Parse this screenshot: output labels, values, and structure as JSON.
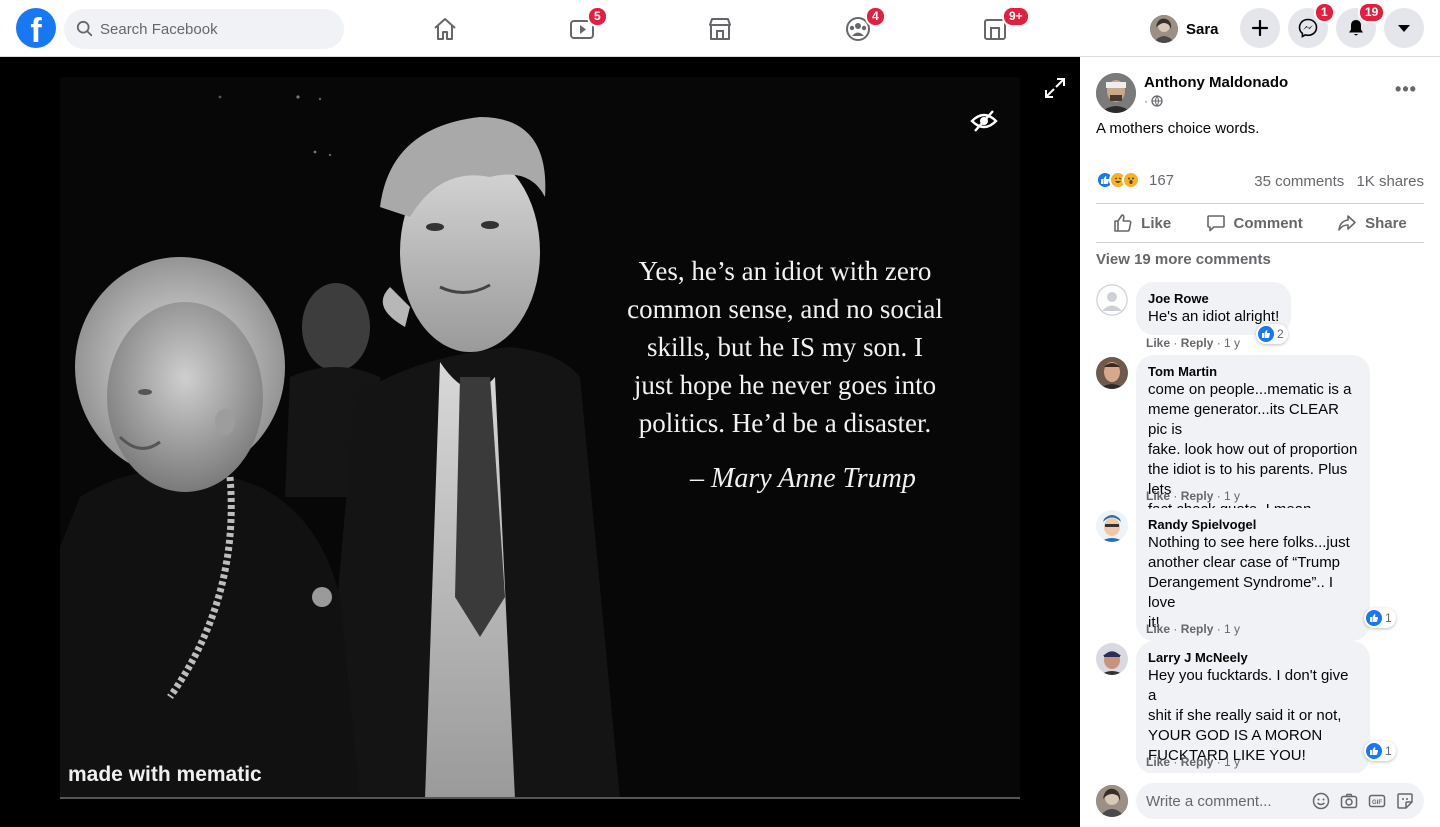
{
  "header": {
    "search": {
      "placeholder": "Search Facebook"
    },
    "nav": [
      {
        "name": "home",
        "icon": "home-icon",
        "badge": ""
      },
      {
        "name": "watch",
        "icon": "watch-icon",
        "badge": "5"
      },
      {
        "name": "marketplace",
        "icon": "marketplace-icon",
        "badge": ""
      },
      {
        "name": "groups",
        "icon": "groups-icon",
        "badge": "4"
      },
      {
        "name": "gaming",
        "icon": "gaming-icon",
        "badge": "9+"
      }
    ],
    "profile_name": "Sara",
    "messenger_badge": "1",
    "notifications_badge": "19",
    "colors": {
      "brand": "#1877f2",
      "badge": "#e41e3f"
    }
  },
  "photo": {
    "quote_lines": [
      "Yes, he’s an idiot with zero",
      "common sense, and no social",
      "skills, but he IS my son.  I",
      "just hope he never goes into",
      "politics. He’d be a disaster."
    ],
    "attribution": "– Mary Anne Trump",
    "watermark": "made with mematic"
  },
  "post": {
    "author": "Anthony Maldonado",
    "meta_dot": "·",
    "text": "A mothers choice words.",
    "reaction_count": "167",
    "comments_count": "35 comments",
    "shares_count": "1K shares",
    "actions": {
      "like": "Like",
      "comment": "Comment",
      "share": "Share"
    },
    "view_more": "View 19 more comments"
  },
  "comments": [
    {
      "name": "Joe Rowe",
      "text": "He's an idiot alright!",
      "like": "Like",
      "reply": "Reply",
      "age": "1 y",
      "reactions": "2"
    },
    {
      "name": "Tom Martin",
      "text": "come on people...mematic is a\nmeme generator...its CLEAR pic is\nfake. look how out of proportion\nthe idiot is to his parents. Plus lets\nfact check quote..I mean really?",
      "like": "Like",
      "reply": "Reply",
      "age": "1 y",
      "reactions": ""
    },
    {
      "name": "Randy Spielvogel",
      "text": "Nothing to see here folks...just\nanother clear case of “Trump\nDerangement Syndrome”.. I love\nit!",
      "like": "Like",
      "reply": "Reply",
      "age": "1 y",
      "reactions": "1"
    },
    {
      "name": "Larry J McNeely",
      "text": "Hey you fucktards. I don't give a\nshit if she really said it or not,\nYOUR GOD IS A MORON\nFUCKTARD LIKE YOU!",
      "like": "Like",
      "reply": "Reply",
      "age": "1 y",
      "reactions": "1"
    }
  ],
  "composer": {
    "placeholder": "Write a comment..."
  }
}
